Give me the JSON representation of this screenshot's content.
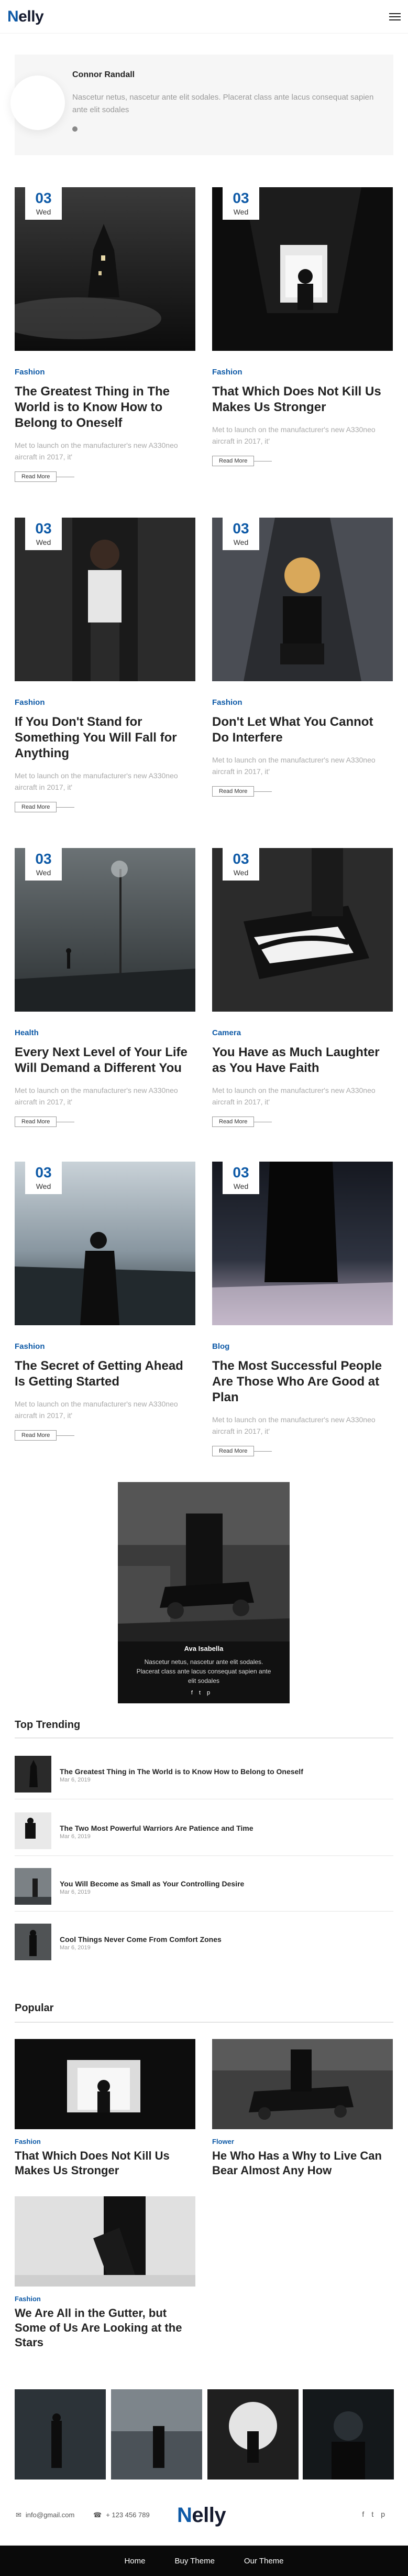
{
  "brand": {
    "logo_first": "N",
    "logo_rest": "elly"
  },
  "author_card": {
    "name": "Connor Randall",
    "text": "Nascetur netus, nascetur ante elit sodales. Placerat class ante lacus consequat sapien ante elit sodales"
  },
  "posts": [
    {
      "day": "03",
      "dow": "Wed",
      "category": "Fashion",
      "title": "The Greatest Thing in The World is to Know How to Belong to Oneself",
      "excerpt": "Met to launch on the manufacturer's new A330neo aircraft in 2017, it'",
      "read_more": "Read More"
    },
    {
      "day": "03",
      "dow": "Wed",
      "category": "Fashion",
      "title": "That Which Does Not Kill Us Makes Us Stronger",
      "excerpt": "Met to launch on the manufacturer's new A330neo aircraft in 2017, it'",
      "read_more": "Read More"
    },
    {
      "day": "03",
      "dow": "Wed",
      "category": "Fashion",
      "title": "If You Don't Stand for Something You Will Fall for Anything",
      "excerpt": "Met to launch on the manufacturer's new A330neo aircraft in 2017, it'",
      "read_more": "Read More"
    },
    {
      "day": "03",
      "dow": "Wed",
      "category": "Fashion",
      "title": "Don't Let What You Cannot Do Interfere",
      "excerpt": "Met to launch on the manufacturer's new A330neo aircraft in 2017, it'",
      "read_more": "Read More"
    },
    {
      "day": "03",
      "dow": "Wed",
      "category": "Health",
      "title": "Every Next Level of Your Life Will Demand a Different You",
      "excerpt": "Met to launch on the manufacturer's new A330neo aircraft in 2017, it'",
      "read_more": "Read More"
    },
    {
      "day": "03",
      "dow": "Wed",
      "category": "Camera",
      "title": "You Have as Much Laughter as You Have Faith",
      "excerpt": "Met to launch on the manufacturer's new A330neo aircraft in 2017, it'",
      "read_more": "Read More"
    },
    {
      "day": "03",
      "dow": "Wed",
      "category": "Fashion",
      "title": "The Secret of Getting Ahead Is Getting Started",
      "excerpt": "Met to launch on the manufacturer's new A330neo aircraft in 2017, it'",
      "read_more": "Read More"
    },
    {
      "day": "03",
      "dow": "Wed",
      "category": "Blog",
      "title": "The Most Successful People Are Those Who Are Good at Plan",
      "excerpt": "Met to launch on the manufacturer's new A330neo aircraft in 2017, it'",
      "read_more": "Read More"
    }
  ],
  "feature_author": {
    "name": "Ava Isabella",
    "text": "Nascetur netus, nascetur ante elit sodales. Placerat class ante lacus consequat sapien ante elit sodales",
    "social": [
      "f",
      "t",
      "p"
    ]
  },
  "top_trending": {
    "heading": "Top Trending",
    "items": [
      {
        "title": "The Greatest Thing in The World is to Know How to Belong to Oneself",
        "date": "Mar 6, 2019"
      },
      {
        "title": "The Two Most Powerful Warriors Are Patience and Time",
        "date": "Mar 6, 2019"
      },
      {
        "title": "You Will Become as Small as Your Controlling Desire",
        "date": "Mar 6, 2019"
      },
      {
        "title": "Cool Things Never Come From Comfort Zones",
        "date": "Mar 6, 2019"
      }
    ]
  },
  "popular": {
    "heading": "Popular",
    "items": [
      {
        "category": "Fashion",
        "title": "That Which Does Not Kill Us Makes Us Stronger"
      },
      {
        "category": "Flower",
        "title": "He Who Has a Why to Live Can Bear Almost Any How"
      },
      {
        "category": "Fashion",
        "title": "We Are All in the Gutter, but Some of Us Are Looking at the Stars"
      }
    ]
  },
  "footer": {
    "email": "info@gmail.com",
    "phone": "+ 123 456 789",
    "social": [
      "f",
      "t",
      "p"
    ],
    "nav": [
      "Home",
      "Buy Theme",
      "Our Theme"
    ]
  },
  "colors": {
    "accent": "#0e5aa7",
    "dark": "#151a2e",
    "muted": "#999999"
  }
}
